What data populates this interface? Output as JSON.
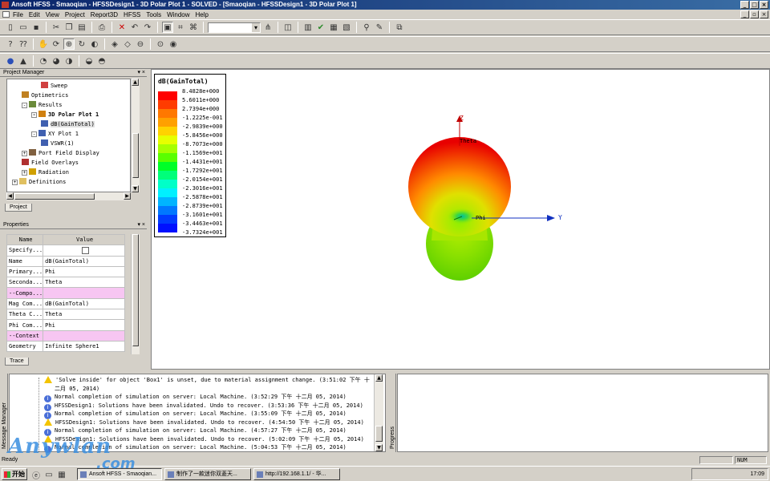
{
  "window": {
    "title": "Ansoft HFSS - Smaoqian - HFSSDesign1 - 3D Polar Plot 1 - SOLVED - [Smaoqian - HFSSDesign1 - 3D Polar Plot 1]"
  },
  "menu": [
    "File",
    "Edit",
    "View",
    "Project",
    "Report3D",
    "HFSS",
    "Tools",
    "Window",
    "Help"
  ],
  "project_manager": {
    "title": "Project Manager",
    "tab": "Project",
    "tree": [
      {
        "label": "Sweep",
        "indent": 4,
        "icon": "sweep-icon",
        "bold": false
      },
      {
        "label": "Optimetrics",
        "indent": 2,
        "icon": "optimetrics-icon",
        "bold": false
      },
      {
        "label": "Results",
        "indent": 2,
        "icon": "results-icon",
        "bold": false,
        "expander": "-"
      },
      {
        "label": "3D Polar Plot 1",
        "indent": 3,
        "icon": "polar-plot-icon",
        "bold": true,
        "expander": "-"
      },
      {
        "label": "dB(GainTotal)",
        "indent": 4,
        "icon": "trace-icon",
        "bold": false,
        "selected": true
      },
      {
        "label": "XY Plot 1",
        "indent": 3,
        "icon": "xy-plot-icon",
        "bold": false,
        "expander": "-"
      },
      {
        "label": "VSWR(1)",
        "indent": 4,
        "icon": "trace-icon",
        "bold": false
      },
      {
        "label": "Port Field Display",
        "indent": 2,
        "icon": "port-icon",
        "bold": false,
        "expander": "+"
      },
      {
        "label": "Field Overlays",
        "indent": 2,
        "icon": "field-icon",
        "bold": false
      },
      {
        "label": "Radiation",
        "indent": 2,
        "icon": "radiation-icon",
        "bold": false,
        "expander": "+"
      },
      {
        "label": "Definitions",
        "indent": 1,
        "icon": "folder-icon",
        "bold": false,
        "expander": "+"
      }
    ]
  },
  "properties": {
    "title": "Properties",
    "tab": "Trace",
    "header_name": "Name",
    "header_value": "Value",
    "rows": [
      {
        "name": "Specify...",
        "value": "",
        "checkbox": true
      },
      {
        "name": "Name",
        "value": "dB(GainTotal)"
      },
      {
        "name": "Primary...",
        "value": "Phi"
      },
      {
        "name": "Seconda...",
        "value": "Theta"
      },
      {
        "name": "--Compo...",
        "value": "",
        "highlight": true
      },
      {
        "name": "Mag Com...",
        "value": "dB(GainTotal)"
      },
      {
        "name": "Theta C...",
        "value": "Theta"
      },
      {
        "name": "Phi Com...",
        "value": "Phi"
      },
      {
        "name": "--Context",
        "value": "",
        "highlight": true
      },
      {
        "name": "Geometry",
        "value": "Infinite Sphere1"
      }
    ]
  },
  "legend": {
    "title": "dB(GainTotal)",
    "ticks": [
      "8.4828e+000",
      "5.6011e+000",
      "2.7394e+000",
      "-1.2225e-001",
      "-2.9839e+000",
      "-5.8456e+000",
      "-8.7073e+000",
      "-1.1569e+001",
      "-1.4431e+001",
      "-1.7292e+001",
      "-2.0154e+001",
      "-2.3016e+001",
      "-2.5878e+001",
      "-2.8739e+001",
      "-3.1601e+001",
      "-3.4463e+001",
      "-3.7324e+001"
    ],
    "colors": [
      "#ff0000",
      "#ff3c00",
      "#ff7800",
      "#ffa000",
      "#ffd200",
      "#e6ff00",
      "#a6ff00",
      "#5aff00",
      "#00ff28",
      "#00ff7a",
      "#00ffc8",
      "#00f0ff",
      "#00b4ff",
      "#0078ff",
      "#003cff",
      "#0010ff"
    ]
  },
  "axes": {
    "z": "Z",
    "y": "Y",
    "theta": "Theta",
    "phi": "Phi"
  },
  "messages": [
    {
      "type": "warn",
      "text": "'Solve inside' for object 'Box1' is unset, due to material assignment change.  (3:51:02 下午  十"
    },
    {
      "type": "none",
      "text": "二月 05, 2014)"
    },
    {
      "type": "info",
      "text": "Normal completion of simulation on server: Local Machine.  (3:52:29 下午  十二月 05, 2014)"
    },
    {
      "type": "info",
      "text": "HFSSDesign1: Solutions have been invalidated. Undo to recover.  (3:53:36 下午  十二月 05, 2014)"
    },
    {
      "type": "info",
      "text": "Normal completion of simulation on server: Local Machine.  (3:55:09 下午  十二月 05, 2014)"
    },
    {
      "type": "warn",
      "text": "HFSSDesign1: Solutions have been invalidated. Undo to recover.  (4:54:50 下午  十二月 05, 2014)"
    },
    {
      "type": "info",
      "text": "Normal completion of simulation on server: Local Machine.  (4:57:27 下午  十二月 05, 2014)"
    },
    {
      "type": "warn",
      "text": "HFSSDesign1: Solutions have been invalidated. Undo to recover.  (5:02:09 下午  十二月 05, 2014)"
    },
    {
      "type": "info",
      "text": "Normal completion of simulation on server: Local Machine.  (5:04:53 下午  十二月 05, 2014)"
    }
  ],
  "message_manager_label": "Message Manager",
  "progress_label": "Progress",
  "status": {
    "text": "Ready",
    "num": "NUM"
  },
  "taskbar": {
    "start": "开始",
    "tasks": [
      "Ansoft HFSS - Smaoqian...",
      "制作了一款迷你双菱天...",
      "http://192.168.1.1/ - 华..."
    ],
    "clock": "17:09"
  },
  "watermark": {
    "line1": "Anywlan",
    "line2": ".com"
  }
}
